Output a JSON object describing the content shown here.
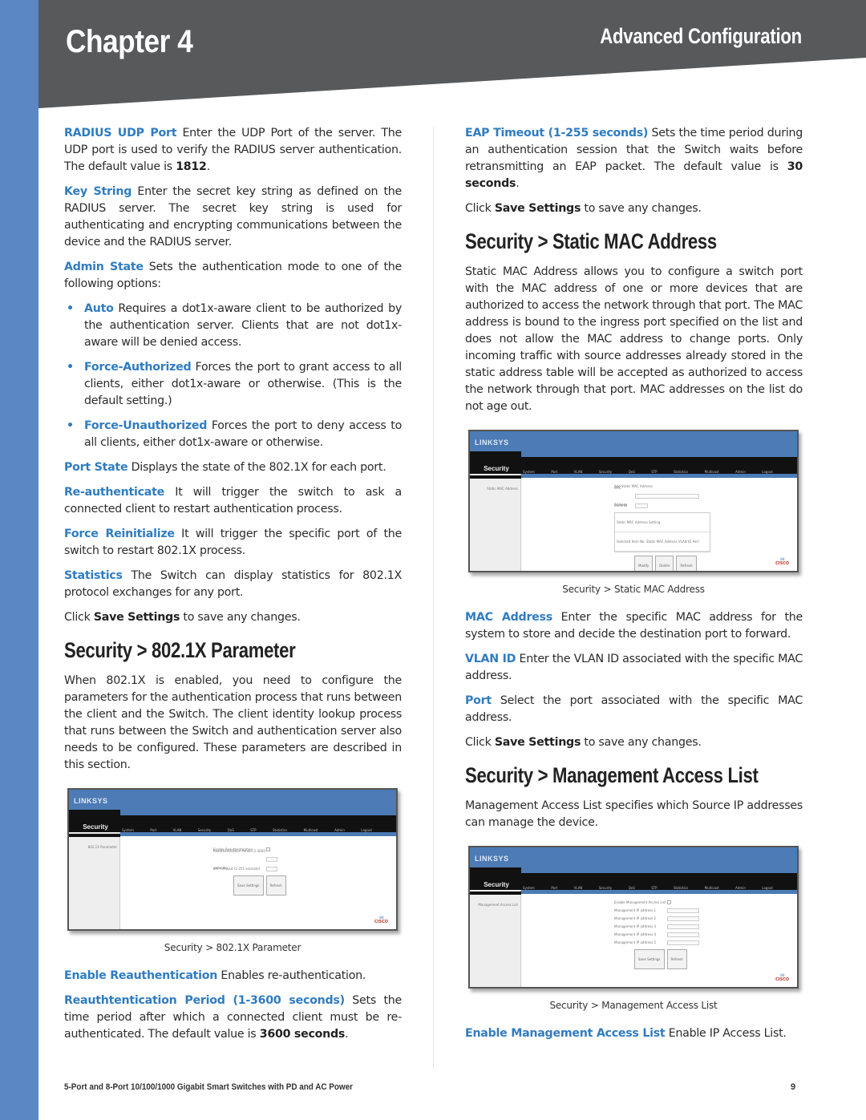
{
  "header": {
    "chapter": "Chapter 4",
    "section": "Advanced Configuration"
  },
  "colors": {
    "accent_blue": "#2f7cc1",
    "strip_blue": "#5b87c5",
    "header_gray": "#58595b"
  },
  "left": {
    "radius_udp_port": {
      "term": "RADIUS UDP Port",
      "text": " Enter the UDP Port of the server. The UDP port is used to verify the RADIUS server authentication. The default value is ",
      "bold": "1812",
      "end": "."
    },
    "key_string": {
      "term": "Key String",
      "text": " Enter the secret key string as defined on the RADIUS server. The secret key string is used for authenticating and encrypting communications between the device and the RADIUS server."
    },
    "admin_state": {
      "term": "Admin State",
      "text": " Sets the authentication mode to one of the following options:"
    },
    "bullets": [
      {
        "term": "Auto",
        "text": " Requires a dot1x-aware client to be authorized by the authentication server. Clients that are not dot1x-aware will be denied access."
      },
      {
        "term": "Force-Authorized",
        "text": " Forces the port to grant access to all clients, either dot1x-aware or otherwise. (This is the default setting.)"
      },
      {
        "term": "Force-Unauthorized",
        "text": " Forces the port to deny access to all clients, either dot1x-aware or otherwise."
      }
    ],
    "port_state": {
      "term": "Port State",
      "text": " Displays the state of the 802.1X for each port."
    },
    "re_authenticate": {
      "term": "Re-authenticate",
      "text": " It will trigger the switch to ask a connected client to restart authentication process."
    },
    "force_reinitialize": {
      "term": "Force Reinitialize",
      "text": " It will trigger the specific port of the switch to restart 802.1X process."
    },
    "statistics": {
      "term": "Statistics",
      "text": " The Switch can display statistics for 802.1X protocol exchanges for any port."
    },
    "save_note": {
      "pre": "Click ",
      "bold": "Save Settings",
      "post": " to save any changes."
    },
    "section_8021x": {
      "heading": "Security > 802.1X Parameter",
      "intro": "When 802.1X is enabled, you need to configure the parameters for the authentication process that runs between the client and the Switch. The client identity lookup process that runs between the Switch and authentication server also needs to be configured. These parameters are described in this section.",
      "caption": "Security > 802.1X Parameter"
    },
    "enable_reauth": {
      "term": "Enable Reauthentication",
      "text": " Enables re-authentication."
    },
    "reauth_period": {
      "term": "Reauthtentication Period (1-3600 seconds)",
      "text": " Sets the time period after which a connected client must be re-authenticated. The default value is ",
      "bold": "3600 seconds",
      "end": "."
    }
  },
  "right": {
    "eap_timeout": {
      "term": "EAP Timeout (1-255 seconds)",
      "text": " Sets the time period during an authentication session that the Switch waits before retransmitting an EAP packet. The default value is ",
      "bold": "30 seconds",
      "end": "."
    },
    "save_note_1": {
      "pre": "Click ",
      "bold": "Save Settings",
      "post": " to save any changes."
    },
    "section_static_mac": {
      "heading": "Security > Static MAC Address",
      "intro": "Static MAC Address allows you to configure a switch port with the MAC address of one or more devices that are authorized to access the network through that port. The MAC address is bound to the ingress port specified on the list and does not allow the MAC address to change ports. Only incoming traffic with source addresses already stored in the static address table will be accepted as authorized to access the network through that port. MAC addresses on the list do not age out.",
      "caption": "Security > Static MAC Address"
    },
    "mac_address": {
      "term": "MAC Address",
      "text": " Enter the specific MAC address for the system to store and decide the destination port to forward."
    },
    "vlan_id": {
      "term": "VLAN ID",
      "text": " Enter the VLAN ID associated with the specific MAC address."
    },
    "port": {
      "term": "Port",
      "text": " Select the port associated with the specific MAC address."
    },
    "save_note_2": {
      "pre": "Click ",
      "bold": "Save Settings",
      "post": " to save any changes."
    },
    "section_mgmt_acl": {
      "heading": "Security > Management Access List",
      "intro": "Management Access List specifies which Source IP addresses can manage the device.",
      "caption": "Security > Management Access List"
    },
    "enable_mgmt_acl": {
      "term": "Enable Management Access List",
      "text": " Enable IP Access List."
    }
  },
  "screenshots": {
    "logo": "LINKSYS",
    "section": "Security",
    "tabs": [
      "System",
      "Port",
      "VLAN",
      "Security",
      "QoS",
      "STP",
      "Statistics",
      "Multicast",
      "Admin",
      "Logout"
    ],
    "cisco_bars": "ılıılı",
    "cisco_word": "CISCO",
    "dot1x": {
      "side_item": "802.1X Parameter",
      "rows": [
        "Enable Reauthentication",
        "Reauthentication Period (1-3600 seconds)",
        "EAP timeout (1-255 seconds)"
      ],
      "buttons": [
        "Save Settings",
        "Refresh"
      ]
    },
    "static_mac": {
      "side_item": "Static MAC Address",
      "rows": [
        "Add Static MAC Address",
        "MAC Address",
        "VLAN ID"
      ],
      "table_header": "Static MAC Address Setting",
      "table_cols": "Selected  Item No.  Static MAC Address  VLAN ID  Port",
      "buttons": [
        "Modify",
        "Delete",
        "Refresh"
      ]
    },
    "mgmt_acl": {
      "side_item": "Management Access List",
      "rows": [
        "Enable Management Access List",
        "Management IP address 1",
        "Management IP address 2",
        "Management IP address 3",
        "Management IP address 4",
        "Management IP address 5"
      ],
      "buttons": [
        "Save Settings",
        "Refresh"
      ]
    }
  },
  "footer": {
    "product": "5-Port and 8-Port 10/100/1000 Gigabit Smart Switches with PD and AC Power",
    "page": "9"
  }
}
